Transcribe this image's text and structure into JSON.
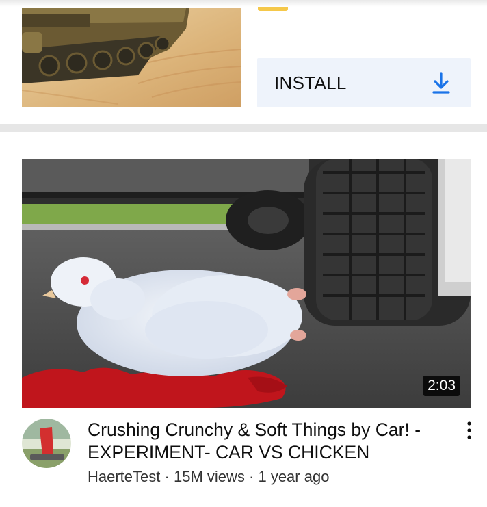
{
  "ad": {
    "install_label": "INSTALL",
    "icons": {
      "download": "download-arrow-icon"
    },
    "colors": {
      "button_bg": "#eef3fb",
      "icon": "#1a73e8",
      "badge": "#f5c84a"
    }
  },
  "video": {
    "duration": "2:03",
    "title": "Crushing Crunchy & Soft Things by Car! - EXPERIMENT- CAR VS CHICKEN",
    "channel": "HaerteTest",
    "views": "15M views",
    "separator": "·",
    "age": "1 year ago",
    "icons": {
      "more": "more-vertical-icon"
    }
  }
}
